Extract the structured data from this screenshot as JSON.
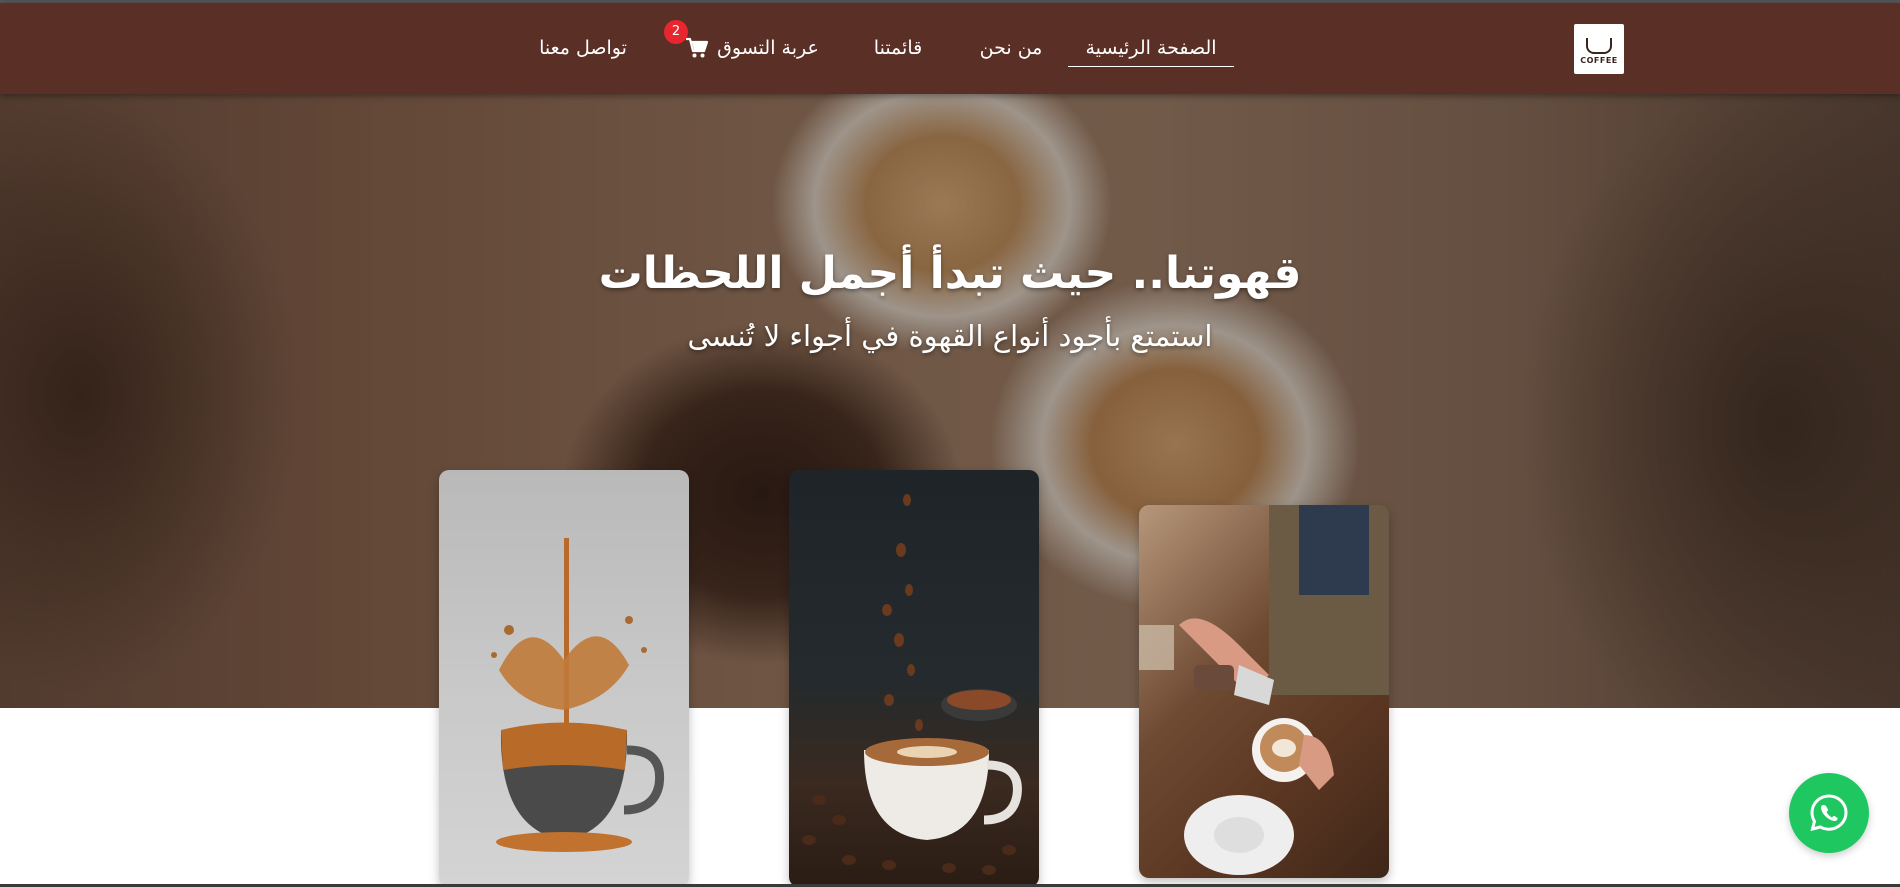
{
  "nav": {
    "home": "الصفحة الرئيسية",
    "about": "من نحن",
    "menu": "قائمتنا",
    "cart": "عربة التسوق",
    "cart_count": "2",
    "contact": "تواصل معنا",
    "logo_text": "COFFEE"
  },
  "hero": {
    "title": "قهوتنا.. حيث تبدأ أجمل اللحظات",
    "subtitle": "استمتع بأجود أنواع القهوة في أجواء لا تُنسى"
  },
  "colors": {
    "navbar": "#5a2f25",
    "badge": "#e8262f",
    "whatsapp": "#1fc761"
  },
  "icons": {
    "cart": "shopping-cart-icon",
    "whatsapp": "whatsapp-icon"
  }
}
